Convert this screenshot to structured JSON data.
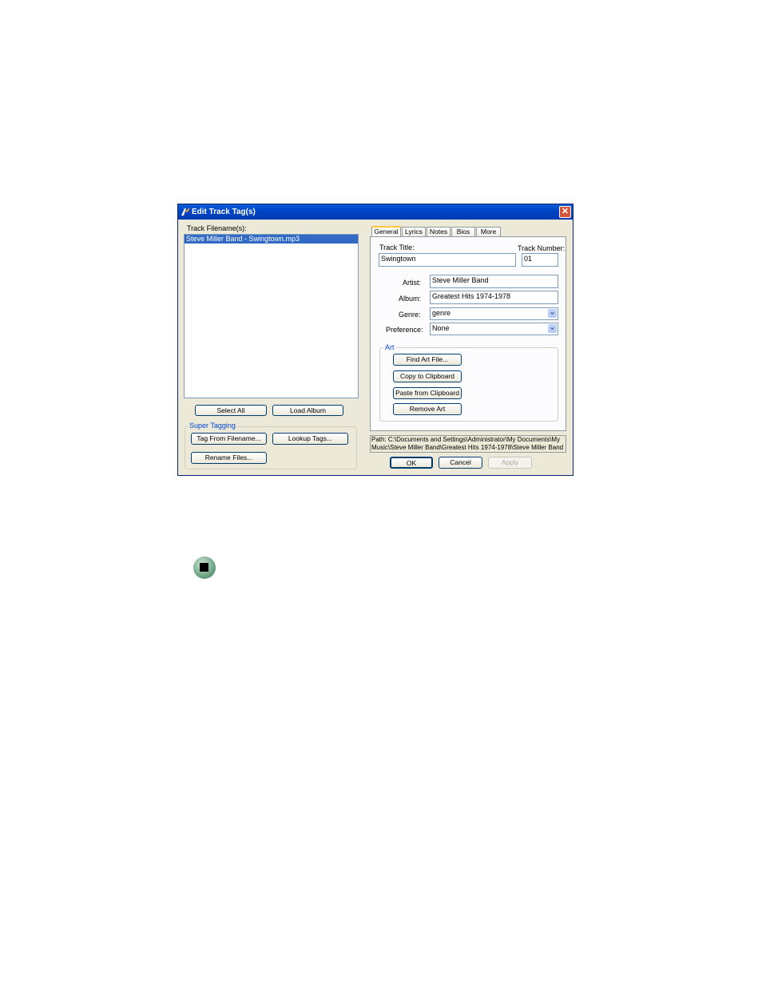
{
  "window": {
    "title": "Edit Track Tag(s)",
    "close_glyph": "✕"
  },
  "left": {
    "track_filenames_label": "Track Filename(s):",
    "files": [
      "Steve Miller Band - Swingtown.mp3"
    ],
    "select_all": "Select All",
    "load_album": "Load Album",
    "super_tagging": {
      "title": "Super Tagging",
      "tag_from_filename": "Tag From Filename...",
      "lookup_tags": "Lookup Tags...",
      "rename_files": "Rename Files..."
    }
  },
  "tabs": [
    "General",
    "Lyrics",
    "Notes",
    "Bios",
    "More"
  ],
  "general": {
    "track_title_label": "Track Title:",
    "track_title": "Swingtown",
    "track_number_label": "Track Number:",
    "track_number": "01",
    "artist_label": "Artist:",
    "artist": "Steve Miller Band",
    "album_label": "Album:",
    "album": "Greatest Hits 1974-1978",
    "genre_label": "Genre:",
    "genre": "genre",
    "preference_label": "Preference:",
    "preference": "None",
    "art": {
      "title": "Art",
      "find_art_file": "Find Art File...",
      "copy_to_clipboard": "Copy to Clipboard",
      "paste_from_clipboard": "Paste from Clipboard",
      "remove_art": "Remove Art"
    }
  },
  "path": {
    "line1": "Path: C:\\Documents and Settings\\Administrator\\My Documents\\My",
    "line2": "Music\\Steve Miller Band\\Greatest Hits 1974-1978\\Steve Miller Band"
  },
  "footer": {
    "ok": "OK",
    "cancel": "Cancel",
    "apply": "Apply"
  },
  "icons": {
    "title": "app-icon",
    "close": "close-icon",
    "dropdown": "chevron-down-icon",
    "end": "stop-icon"
  }
}
